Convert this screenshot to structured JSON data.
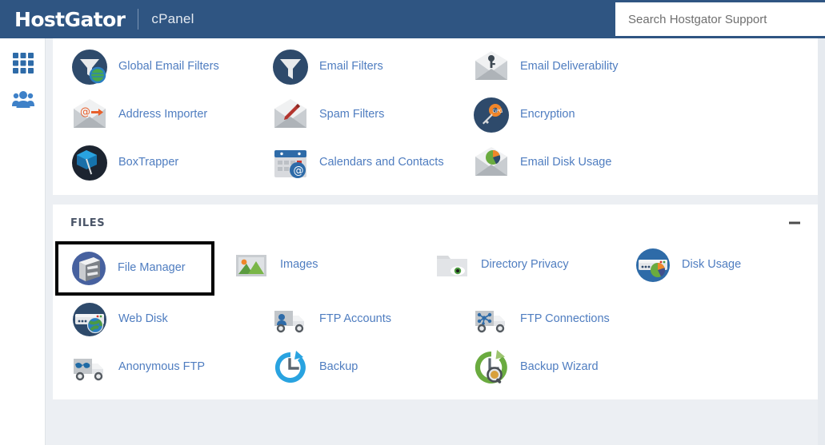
{
  "header": {
    "brand": "HostGator",
    "subtitle": "cPanel",
    "search_placeholder": "Search Hostgator Support",
    "bg_color": "#2f5582"
  },
  "sidebar": {
    "items": [
      {
        "name": "apps-grid-icon",
        "label": "Apps"
      },
      {
        "name": "user-manager-icon",
        "label": "User Manager"
      }
    ]
  },
  "sections": [
    {
      "id": "email",
      "title": "",
      "collapsible": false,
      "items": [
        {
          "label": "Global Email Filters",
          "icon": "global-email-filters-icon"
        },
        {
          "label": "Email Filters",
          "icon": "email-filters-icon"
        },
        {
          "label": "Email Deliverability",
          "icon": "email-deliverability-icon"
        },
        {
          "label": "Address Importer",
          "icon": "address-importer-icon"
        },
        {
          "label": "Spam Filters",
          "icon": "spam-filters-icon"
        },
        {
          "label": "Encryption",
          "icon": "encryption-icon"
        },
        {
          "label": "BoxTrapper",
          "icon": "boxtrapper-icon"
        },
        {
          "label": "Calendars and Contacts",
          "icon": "calendars-contacts-icon"
        },
        {
          "label": "Email Disk Usage",
          "icon": "email-disk-usage-icon"
        }
      ]
    },
    {
      "id": "files",
      "title": "FILES",
      "collapsible": true,
      "collapse_label": "−",
      "items": [
        {
          "label": "File Manager",
          "icon": "file-manager-icon",
          "selected": true
        },
        {
          "label": "Images",
          "icon": "images-icon"
        },
        {
          "label": "Directory Privacy",
          "icon": "directory-privacy-icon"
        },
        {
          "label": "Disk Usage",
          "icon": "disk-usage-icon"
        },
        {
          "label": "Web Disk",
          "icon": "web-disk-icon"
        },
        {
          "label": "FTP Accounts",
          "icon": "ftp-accounts-icon"
        },
        {
          "label": "FTP Connections",
          "icon": "ftp-connections-icon"
        },
        {
          "label": "Anonymous FTP",
          "icon": "anonymous-ftp-icon"
        },
        {
          "label": "Backup",
          "icon": "backup-icon"
        },
        {
          "label": "Backup Wizard",
          "icon": "backup-wizard-icon"
        }
      ]
    }
  ],
  "colors": {
    "link": "#4f7dc0",
    "page_bg": "#eceff3",
    "card_bg": "#ffffff",
    "icon_dark_navy": "#2e4a6b",
    "icon_blue": "#29a3e0",
    "icon_green": "#7ab648",
    "icon_orange": "#f0862a",
    "selection_outline": "#000000"
  }
}
